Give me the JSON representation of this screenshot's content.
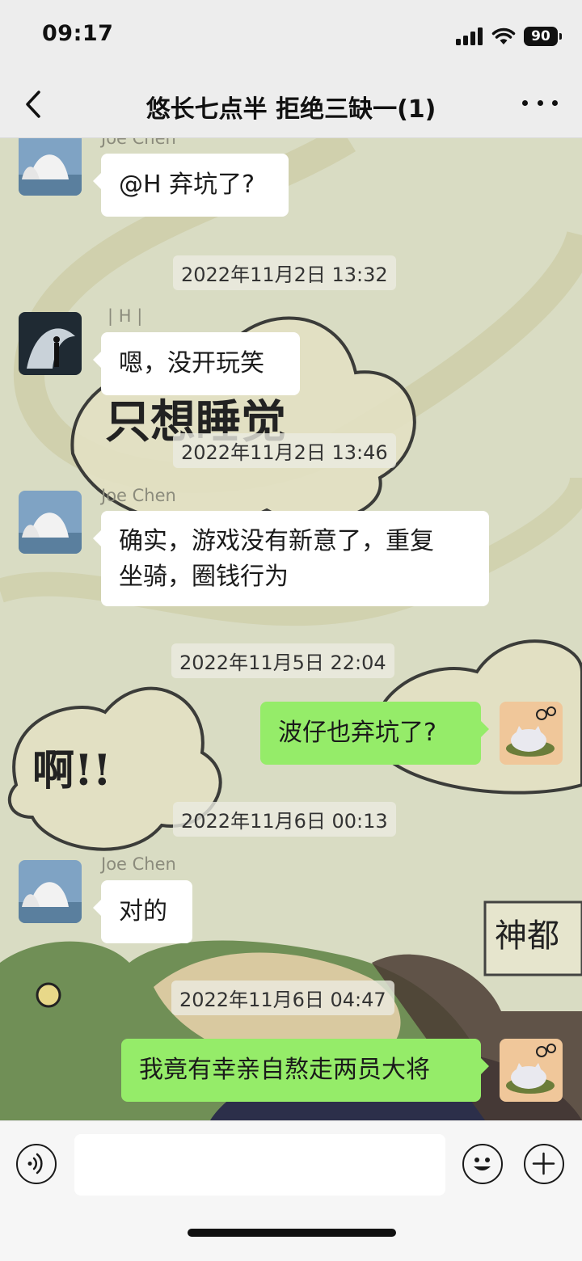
{
  "status_bar": {
    "time": "09:17",
    "battery": "90",
    "icons": [
      "signal-icon",
      "wifi-icon",
      "battery-icon"
    ]
  },
  "nav": {
    "title": "悠长七点半 拒绝三缺一(1)",
    "back_icon": "chevron-left-icon",
    "more_icon": "more-icon"
  },
  "background_text": {
    "sleep": "只想睡觉",
    "ah": "啊!!",
    "brand": "神都"
  },
  "messages": [
    {
      "side": "left",
      "sender": "Joe Chen",
      "text": "@H 弃坑了?",
      "avatar": "opera-house-avatar"
    },
    {
      "type": "timestamp",
      "text": "2022年11月2日 13:32"
    },
    {
      "side": "left",
      "sender": "| H |",
      "text": "嗯，没开玩笑",
      "avatar": "angel-avatar"
    },
    {
      "type": "timestamp",
      "text": "2022年11月2日 13:46"
    },
    {
      "side": "left",
      "sender": "Joe Chen",
      "text_lines": [
        "确实，游戏没有新意了，重复",
        "坐骑，圈钱行为"
      ],
      "avatar": "opera-house-avatar"
    },
    {
      "type": "timestamp",
      "text": "2022年11月5日 22:04"
    },
    {
      "side": "right",
      "text": "波仔也弃坑了?",
      "avatar": "cat-avatar"
    },
    {
      "type": "timestamp",
      "text": "2022年11月6日 00:13"
    },
    {
      "side": "left",
      "sender": "Joe Chen",
      "text": "对的",
      "avatar": "opera-house-avatar"
    },
    {
      "type": "timestamp",
      "text": "2022年11月6日 04:47"
    },
    {
      "side": "right",
      "text": "我竟有幸亲自熬走两员大将",
      "avatar": "cat-avatar"
    }
  ],
  "input_bar": {
    "placeholder": "",
    "voice_icon": "voice-icon",
    "emoji_icon": "emoji-icon",
    "plus_icon": "plus-icon"
  },
  "colors": {
    "chat_bg": "#d9dcc3",
    "self_bubble": "#95ec69",
    "other_bubble": "#ffffff",
    "bar_bg": "#ededed"
  }
}
